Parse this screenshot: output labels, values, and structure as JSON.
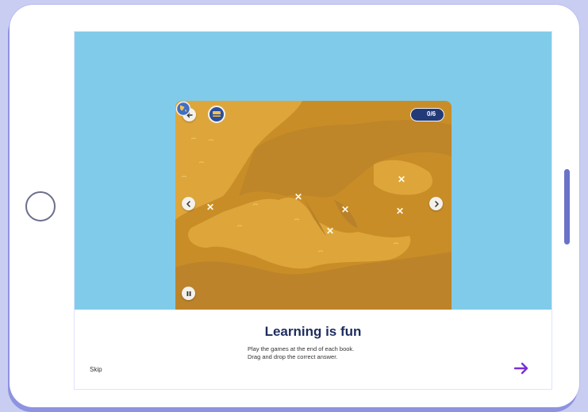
{
  "onboarding": {
    "title": "Learning is fun",
    "description_line1": "Play the games at the end of each book.",
    "description_line2": "Drag and drop the correct answer.",
    "skip_label": "Skip"
  },
  "game": {
    "score_text": "0/6",
    "map_color": "#d69b2e",
    "sky_color": "#80cbe9"
  },
  "icons": {
    "back": "arrow-left-icon",
    "book": "book-icon",
    "globe": "globe-icon",
    "prev": "chevron-left-icon",
    "next_map": "chevron-right-icon",
    "pause": "pause-icon",
    "next_page": "arrow-right-icon",
    "marker": "cross-marker-icon"
  },
  "colors": {
    "accent": "#7b2fd6",
    "title": "#1d2c5e"
  }
}
